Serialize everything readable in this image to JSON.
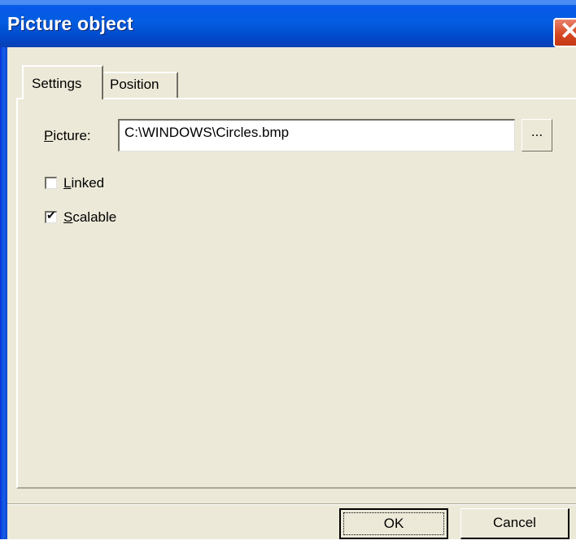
{
  "window": {
    "title": "Picture object",
    "close_glyph": "✕"
  },
  "tabs": [
    {
      "label": "Settings",
      "active": true
    },
    {
      "label": "Position",
      "active": false
    }
  ],
  "picture": {
    "label_prefix": "",
    "label_underlined": "P",
    "label_rest": "icture:",
    "value": "C:\\WINDOWS\\Circles.bmp",
    "browse_label": "..."
  },
  "options": {
    "linked": {
      "underlined": "L",
      "rest": "inked",
      "checked": false
    },
    "scalable": {
      "underlined": "S",
      "rest": "calable",
      "checked": true
    }
  },
  "buttons": {
    "ok": "OK",
    "cancel": "Cancel"
  }
}
